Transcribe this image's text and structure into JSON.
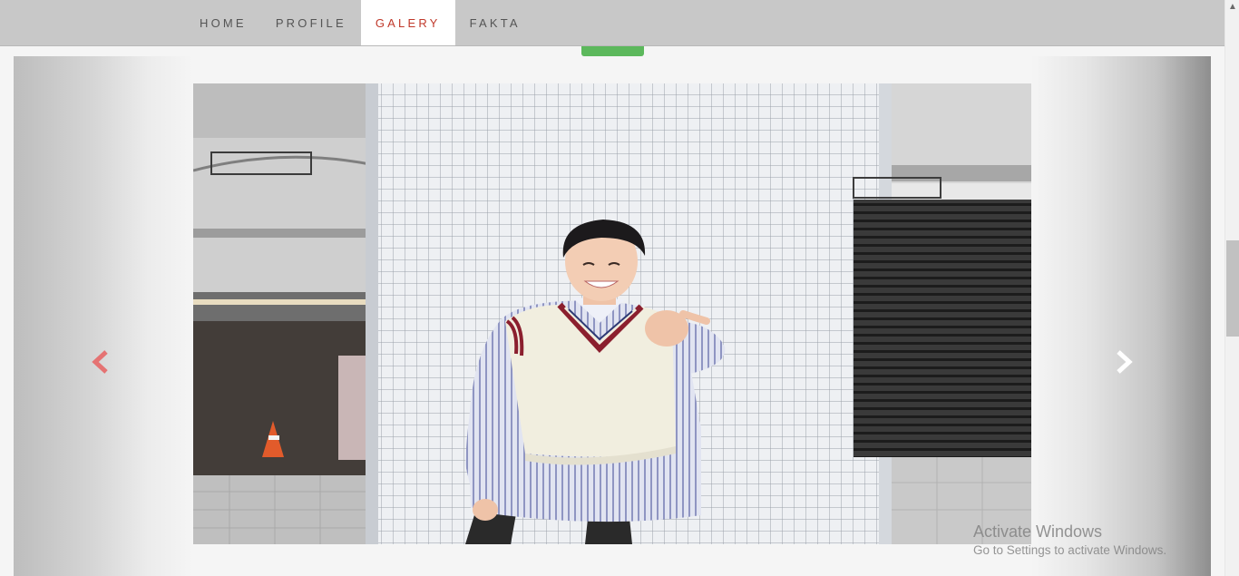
{
  "nav": {
    "items": [
      {
        "label": "HOME",
        "active": false
      },
      {
        "label": "PROFILE",
        "active": false
      },
      {
        "label": "GALERY",
        "active": true
      },
      {
        "label": "FAKTA",
        "active": false
      }
    ]
  },
  "carousel": {
    "prev_icon": "chevron-left-icon",
    "next_icon": "chevron-right-icon",
    "prev_color": "#e57373",
    "next_color": "#ffffff"
  },
  "watermark": {
    "title": "Activate Windows",
    "subtitle": "Go to Settings to activate Windows."
  },
  "colors": {
    "navbar_bg": "#c8c8c8",
    "active_text": "#c0392b",
    "green_button": "#5cb85c"
  }
}
